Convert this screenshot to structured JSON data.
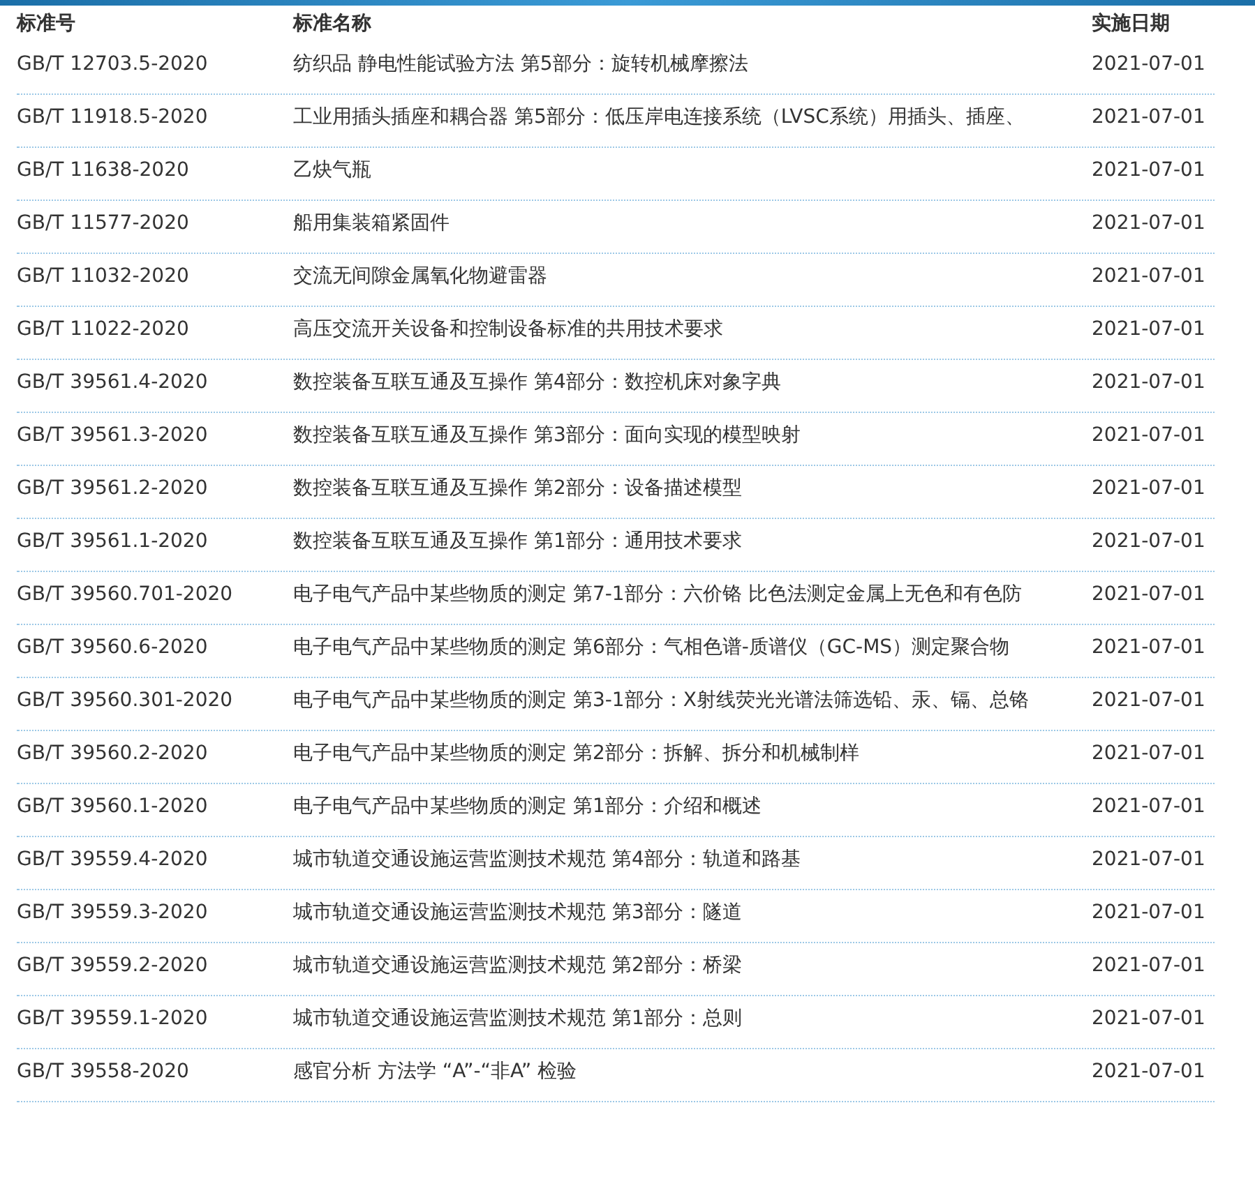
{
  "columns": [
    "标准号",
    "标准名称",
    "实施日期"
  ],
  "rows": [
    {
      "code": "GB/T 12703.5-2020",
      "name": "纺织品 静电性能试验方法 第5部分：旋转机械摩擦法",
      "date": "2021-07-01"
    },
    {
      "code": "GB/T 11918.5-2020",
      "name": "工业用插头插座和耦合器 第5部分：低压岸电连接系统（LVSC系统）用插头、插座、",
      "date": "2021-07-01"
    },
    {
      "code": "GB/T 11638-2020",
      "name": "乙炔气瓶",
      "date": "2021-07-01"
    },
    {
      "code": "GB/T 11577-2020",
      "name": "船用集装箱紧固件",
      "date": "2021-07-01"
    },
    {
      "code": "GB/T 11032-2020",
      "name": "交流无间隙金属氧化物避雷器",
      "date": "2021-07-01"
    },
    {
      "code": "GB/T 11022-2020",
      "name": "高压交流开关设备和控制设备标准的共用技术要求",
      "date": "2021-07-01"
    },
    {
      "code": "GB/T 39561.4-2020",
      "name": "数控装备互联互通及互操作 第4部分：数控机床对象字典",
      "date": "2021-07-01"
    },
    {
      "code": "GB/T 39561.3-2020",
      "name": "数控装备互联互通及互操作 第3部分：面向实现的模型映射",
      "date": "2021-07-01"
    },
    {
      "code": "GB/T 39561.2-2020",
      "name": "数控装备互联互通及互操作 第2部分：设备描述模型",
      "date": "2021-07-01"
    },
    {
      "code": "GB/T 39561.1-2020",
      "name": "数控装备互联互通及互操作 第1部分：通用技术要求",
      "date": "2021-07-01"
    },
    {
      "code": "GB/T 39560.701-2020",
      "name": "电子电气产品中某些物质的测定 第7-1部分：六价铬 比色法测定金属上无色和有色防",
      "date": "2021-07-01"
    },
    {
      "code": "GB/T 39560.6-2020",
      "name": "电子电气产品中某些物质的测定 第6部分：气相色谱-质谱仪（GC-MS）测定聚合物",
      "date": "2021-07-01"
    },
    {
      "code": "GB/T 39560.301-2020",
      "name": "电子电气产品中某些物质的测定 第3-1部分：X射线荧光光谱法筛选铅、汞、镉、总铬",
      "date": "2021-07-01"
    },
    {
      "code": "GB/T 39560.2-2020",
      "name": "电子电气产品中某些物质的测定 第2部分：拆解、拆分和机械制样",
      "date": "2021-07-01"
    },
    {
      "code": "GB/T 39560.1-2020",
      "name": "电子电气产品中某些物质的测定 第1部分：介绍和概述",
      "date": "2021-07-01"
    },
    {
      "code": "GB/T 39559.4-2020",
      "name": "城市轨道交通设施运营监测技术规范 第4部分：轨道和路基",
      "date": "2021-07-01"
    },
    {
      "code": "GB/T 39559.3-2020",
      "name": "城市轨道交通设施运营监测技术规范 第3部分：隧道",
      "date": "2021-07-01"
    },
    {
      "code": "GB/T 39559.2-2020",
      "name": "城市轨道交通设施运营监测技术规范 第2部分：桥梁",
      "date": "2021-07-01"
    },
    {
      "code": "GB/T 39559.1-2020",
      "name": "城市轨道交通设施运营监测技术规范 第1部分：总则",
      "date": "2021-07-01"
    },
    {
      "code": "GB/T 39558-2020",
      "name": "感官分析 方法学 “A”-“非A” 检验",
      "date": "2021-07-01"
    }
  ]
}
